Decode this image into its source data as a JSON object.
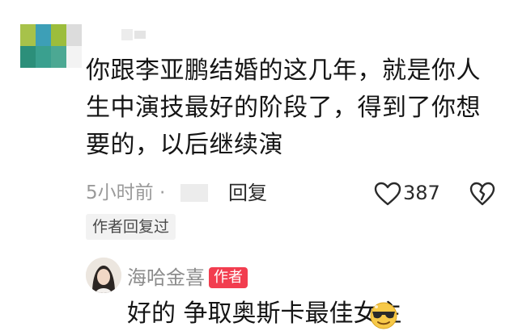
{
  "comment": {
    "text": "你跟李亚鹏结婚的这几年，就是你人生中演技最好的阶段了，得到了你想要的，以后继续演",
    "time": "5小时前 ·",
    "reply_label": "回复",
    "like_count": "387",
    "author_replied_tag": "作者回复过"
  },
  "reply": {
    "username": "海哈金喜",
    "badge": "作者",
    "text": "好的 争取奥斯卡最佳女主",
    "emoji_icon": "sunglasses-cool-emoji"
  },
  "colors": {
    "badge_bg": "#f23d4f",
    "muted_text": "#9a9a9a",
    "tag_bg": "#f2f2f2"
  }
}
